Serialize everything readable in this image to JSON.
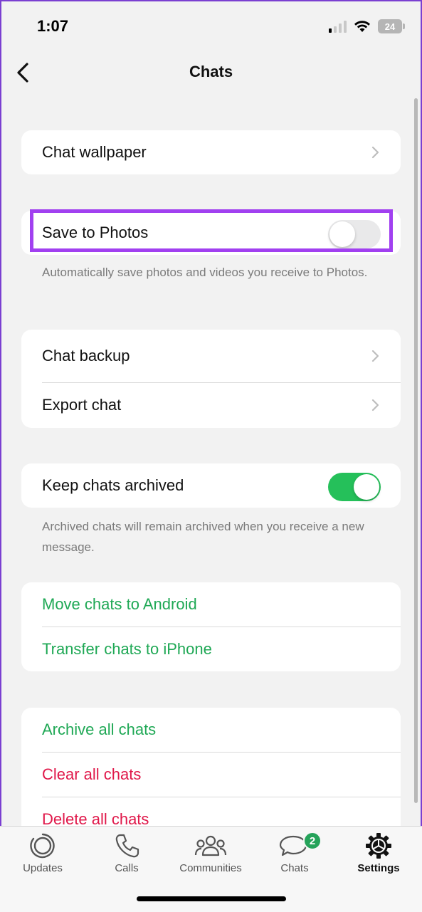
{
  "status_bar": {
    "time": "1:07",
    "battery_level": "24",
    "icons": [
      "cellular-signal-icon",
      "wifi-icon",
      "battery-icon"
    ]
  },
  "nav": {
    "title": "Chats",
    "back_icon": "chevron-left-icon"
  },
  "sections": {
    "wallpaper": {
      "label": "Chat wallpaper"
    },
    "save_photos": {
      "label": "Save to Photos",
      "toggle_on": false,
      "note": "Automatically save photos and videos you receive to Photos."
    },
    "backup": {
      "items": [
        {
          "label": "Chat backup"
        },
        {
          "label": "Export chat"
        }
      ]
    },
    "archived": {
      "label": "Keep chats archived",
      "toggle_on": true,
      "note": "Archived chats will remain archived when you receive a new message."
    },
    "transfer": {
      "items": [
        {
          "label": "Move chats to Android"
        },
        {
          "label": "Transfer chats to iPhone"
        }
      ]
    },
    "danger": {
      "items": [
        {
          "label": "Archive all chats"
        },
        {
          "label": "Clear all chats"
        },
        {
          "label": "Delete all chats"
        }
      ]
    }
  },
  "tab_bar": {
    "tabs": [
      {
        "label": "Updates",
        "icon": "updates-icon"
      },
      {
        "label": "Calls",
        "icon": "phone-icon"
      },
      {
        "label": "Communities",
        "icon": "communities-icon"
      },
      {
        "label": "Chats",
        "icon": "chat-bubbles-icon",
        "badge": "2"
      },
      {
        "label": "Settings",
        "icon": "gear-icon",
        "active": true
      }
    ]
  },
  "colors": {
    "accent_green": "#1fa855",
    "destructive_red": "#e0184a",
    "highlight_purple": "#a140f0",
    "toggle_on": "#25c05a"
  }
}
